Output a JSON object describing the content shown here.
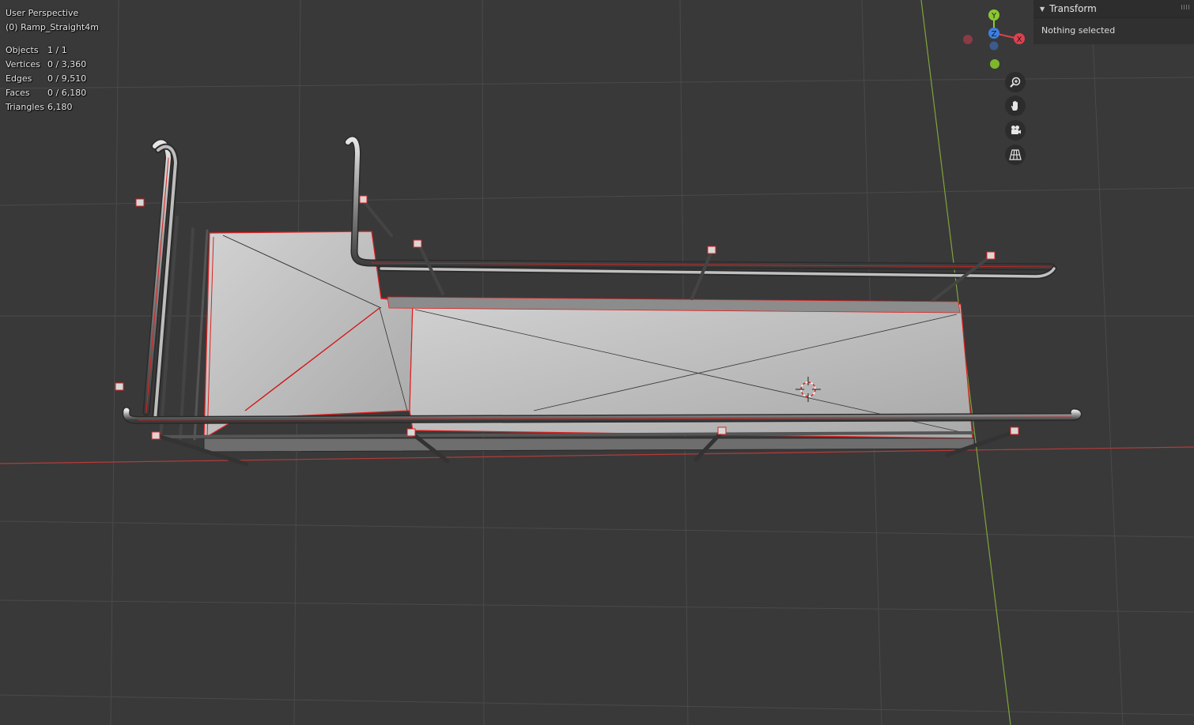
{
  "viewport": {
    "view_name": "User Perspective",
    "object_name": "(0) Ramp_Straight4m",
    "stats": [
      {
        "label": "Objects",
        "value": "1 / 1"
      },
      {
        "label": "Vertices",
        "value": "0 / 3,360"
      },
      {
        "label": "Edges",
        "value": "0 / 9,510"
      },
      {
        "label": "Faces",
        "value": "0 / 6,180"
      },
      {
        "label": "Triangles",
        "value": "6,180"
      }
    ]
  },
  "gizmo": {
    "x_label": "X",
    "y_label": "Y",
    "z_label": "Z",
    "x_color": "#e0404f",
    "y_color": "#8bc832",
    "z_color": "#3d7fe0"
  },
  "navigation": {
    "buttons": [
      "zoom-icon",
      "hand-icon",
      "camera-icon",
      "grid-icon"
    ]
  },
  "panel": {
    "title": "Transform",
    "body": "Nothing selected"
  },
  "colors": {
    "background": "#393939",
    "grid": "#4a4a4a",
    "axis_x": "#b53b3b",
    "axis_y": "#7da53a",
    "mesh_face": "#c4c4c4",
    "mesh_outline": "#e02020"
  }
}
